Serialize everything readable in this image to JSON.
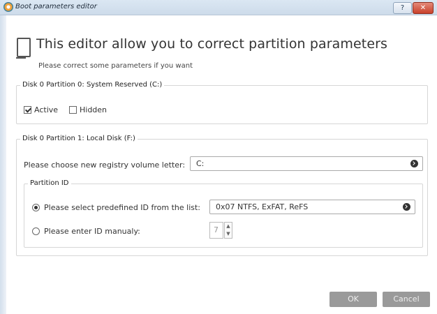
{
  "window": {
    "title": "Boot parameters editor",
    "help_label": "?",
    "close_label": "✕"
  },
  "header": {
    "title": "This editor allow you to correct partition parameters",
    "subtitle": "Please correct some parameters if you want"
  },
  "partition0": {
    "legend": "Disk 0 Partition 0: System Reserved (C:)",
    "active_label": "Active",
    "active_checked": true,
    "hidden_label": "Hidden",
    "hidden_checked": false
  },
  "partition1": {
    "legend": "Disk 0 Partition 1: Local Disk (F:)",
    "volume_letter_label": "Please choose new registry volume letter:",
    "volume_letter_value": "C:",
    "partition_id": {
      "legend": "Partition ID",
      "predefined_label": "Please select predefined ID from the list:",
      "predefined_selected": true,
      "predefined_value": "0x07 NTFS, ExFAT, ReFS",
      "manual_label": "Please enter ID manualy:",
      "manual_value": "7"
    }
  },
  "buttons": {
    "ok_label": "OK",
    "cancel_label": "Cancel"
  }
}
